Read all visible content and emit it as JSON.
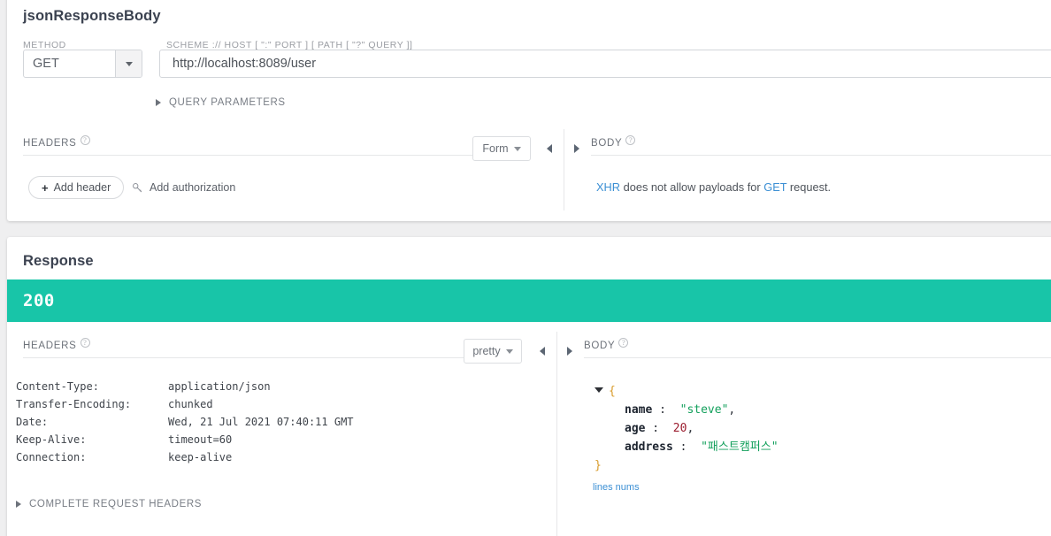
{
  "request": {
    "title": "jsonResponseBody",
    "method_label": "METHOD",
    "method_value": "GET",
    "url_label": "SCHEME :// HOST [ \":\" PORT ] [ PATH [ \"?\" QUERY ]]",
    "url_value": "http://localhost:8089/user",
    "query_parameters_label": "QUERY PARAMETERS",
    "headers": {
      "title": "HEADERS",
      "help_glyph": "?",
      "format_select": "Form",
      "add_header_label": "Add header",
      "add_header_icon": "plus-icon",
      "add_authorization_label": "Add authorization",
      "add_authorization_icon": "key-icon"
    },
    "body": {
      "title": "BODY",
      "help_glyph": "?",
      "note_prefix": "XHR",
      "note_middle": " does not allow payloads for ",
      "note_link2": "GET",
      "note_suffix": " request."
    }
  },
  "response": {
    "title": "Response",
    "status_code": "200",
    "status_color": "#18c5a8",
    "headers": {
      "title": "HEADERS",
      "help_glyph": "?",
      "format_select": "pretty",
      "rows": [
        {
          "key": "Content-Type:",
          "value": "application/json"
        },
        {
          "key": "Transfer-Encoding:",
          "value": "chunked"
        },
        {
          "key": "Date:",
          "value": "Wed, 21 Jul 2021 07:40:11 GMT"
        },
        {
          "key": "Keep-Alive:",
          "value": "timeout=60"
        },
        {
          "key": "Connection:",
          "value": "keep-alive"
        }
      ]
    },
    "body": {
      "title": "BODY",
      "help_glyph": "?",
      "open_brace": "{",
      "close_brace": "}",
      "entries": [
        {
          "key": "name",
          "sep": " : ",
          "value": "\"steve\"",
          "type": "string",
          "comma": ","
        },
        {
          "key": "age",
          "sep": " : ",
          "value": "20",
          "type": "number",
          "comma": ","
        },
        {
          "key": "address",
          "sep": " : ",
          "value": "\"패스트캠퍼스\"",
          "type": "string",
          "comma": ""
        }
      ],
      "lines_nums_label": "lines nums"
    },
    "complete_request_headers_label": "COMPLETE REQUEST HEADERS"
  }
}
